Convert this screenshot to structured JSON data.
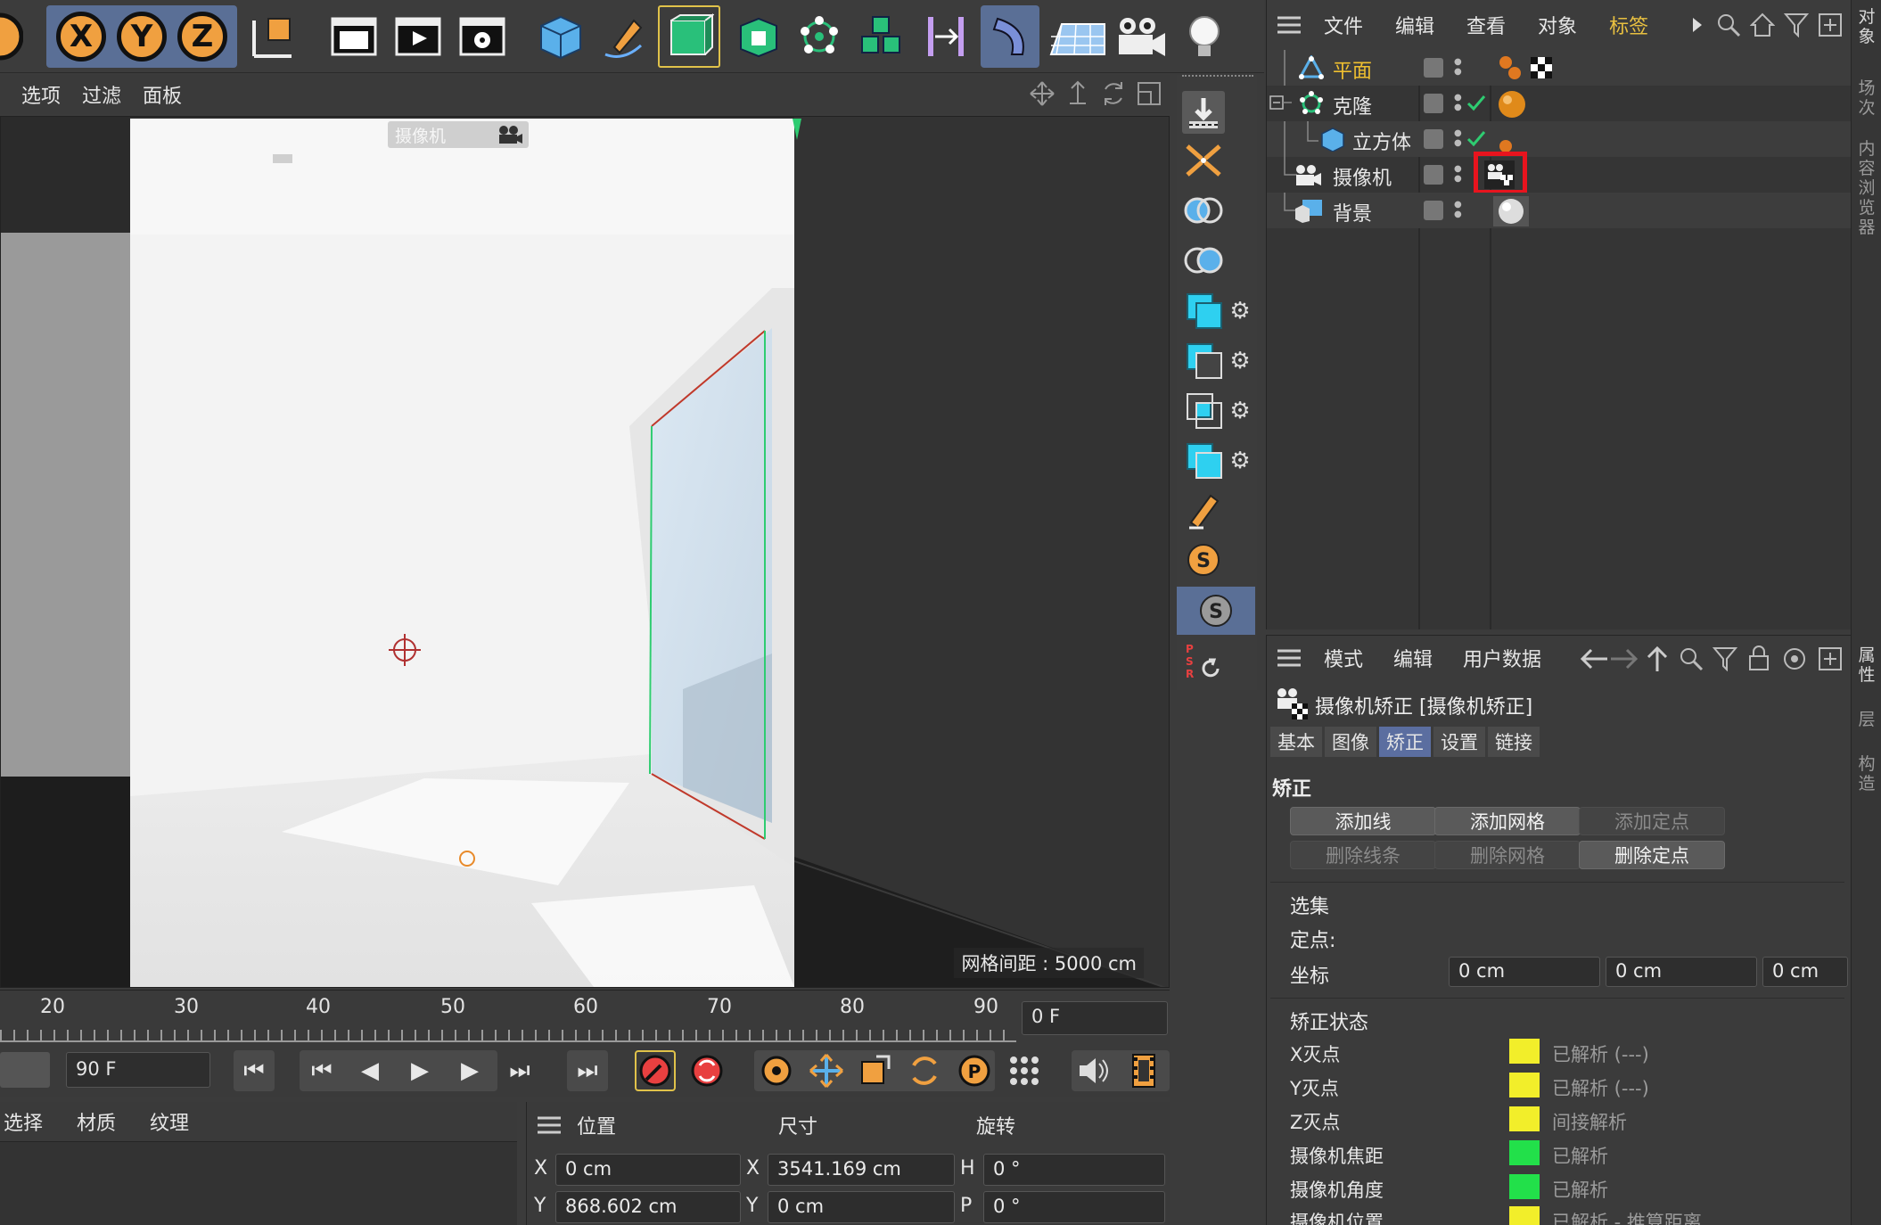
{
  "viewport_menu": {
    "options": "选项",
    "filter": "过滤",
    "panel": "面板"
  },
  "toolbar": {
    "x_axis": "X",
    "y_axis": "Y",
    "z_axis": "Z"
  },
  "viewport": {
    "camera_tag": "摄像机",
    "grid_spacing": "网格间距 : 5000 cm"
  },
  "timeline": {
    "ticks": [
      "20",
      "30",
      "40",
      "50",
      "60",
      "70",
      "80",
      "90"
    ],
    "current_frame": "0 F",
    "end_frame": "90 F"
  },
  "material_menu": {
    "select": "选择",
    "material": "材质",
    "texture": "纹理"
  },
  "coords": {
    "position": "位置",
    "size": "尺寸",
    "rotation": "旋转",
    "x_label": "X",
    "y_label": "Y",
    "pos_x": "0 cm",
    "pos_y": "868.602 cm",
    "size_x": "3541.169 cm",
    "size_y": "0 cm",
    "rot_h_label": "H",
    "rot_p_label": "P",
    "rot_h": "0 °",
    "rot_p": "0 °"
  },
  "object_manager": {
    "menu": {
      "file": "文件",
      "edit": "编辑",
      "view": "查看",
      "object": "对象",
      "tags": "标签"
    },
    "objects": [
      {
        "name": "平面"
      },
      {
        "name": "克隆"
      },
      {
        "name": "立方体"
      },
      {
        "name": "摄像机"
      },
      {
        "name": "背景"
      }
    ]
  },
  "attribute_manager": {
    "menu": {
      "mode": "模式",
      "edit": "编辑",
      "user_data": "用户数据"
    },
    "title": "摄像机矫正 [摄像机矫正]",
    "tabs": [
      "基本",
      "图像",
      "矫正",
      "设置",
      "链接"
    ],
    "section_correct": "矫正",
    "buttons": {
      "add_line": "添加线",
      "add_grid": "添加网格",
      "add_point": "添加定点",
      "delete_lines": "删除线条",
      "delete_grid": "删除网格",
      "delete_point": "删除定点"
    },
    "selection_label": "选集",
    "fixed_point_label": "定点:",
    "coord_label": "坐标",
    "coord_values": [
      "0 cm",
      "0 cm",
      "0 cm"
    ],
    "status_section": "矫正状态",
    "status_rows": [
      {
        "label": "X灭点",
        "value": "已解析 (---)",
        "color": "#f2ee2a"
      },
      {
        "label": "Y灭点",
        "value": "已解析 (---)",
        "color": "#f2ee2a"
      },
      {
        "label": "Z灭点",
        "value": "间接解析",
        "color": "#f2ee2a"
      },
      {
        "label": "摄像机焦距",
        "value": "已解析",
        "color": "#22e04a"
      },
      {
        "label": "摄像机角度",
        "value": "已解析",
        "color": "#22e04a"
      },
      {
        "label": "摄像机位置",
        "value": "已解析 - 推算距离",
        "color": "#f2ee2a"
      }
    ]
  },
  "edge_tabs": [
    "对象",
    "场次",
    "内容浏览器",
    "属性",
    "层",
    "构造"
  ],
  "colors": {
    "accent": "#5b6ea0",
    "highlight_red": "#e8141e",
    "orange": "#f0a040"
  }
}
